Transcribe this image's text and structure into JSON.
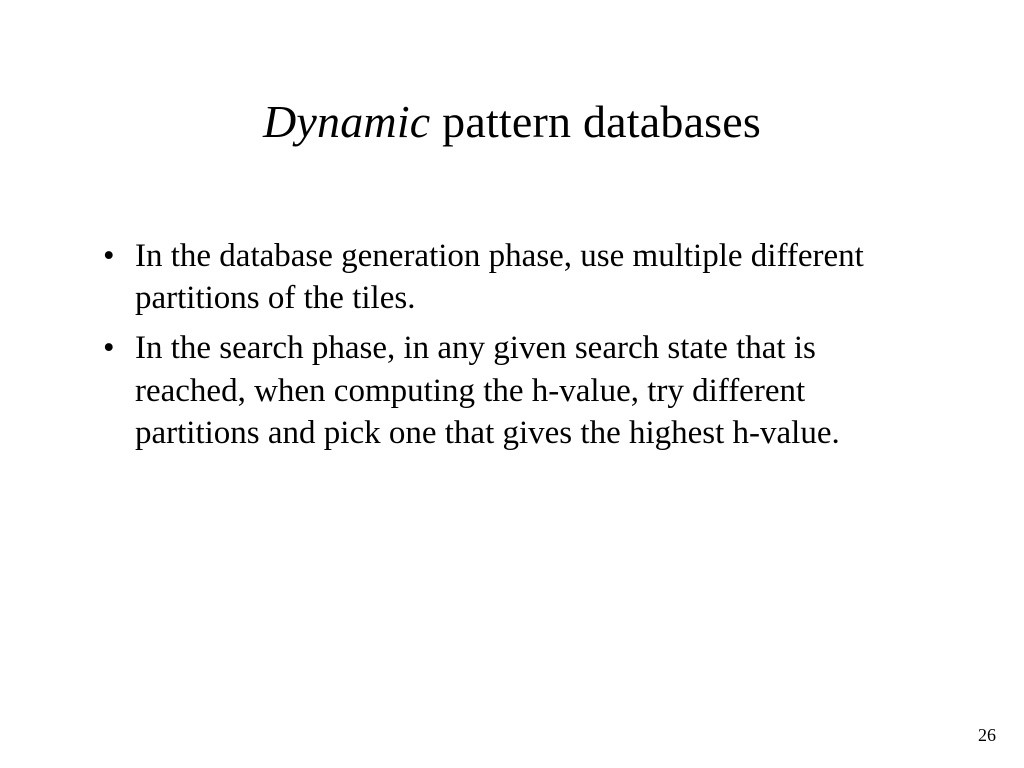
{
  "title": {
    "emphasis": "Dynamic",
    "rest": " pattern databases"
  },
  "bullets": [
    "In the database generation phase, use multiple different partitions of the tiles.",
    "In the search phase, in any given search state that is reached, when computing the h-value, try different partitions and pick one that gives the highest h-value."
  ],
  "page_number": "26"
}
